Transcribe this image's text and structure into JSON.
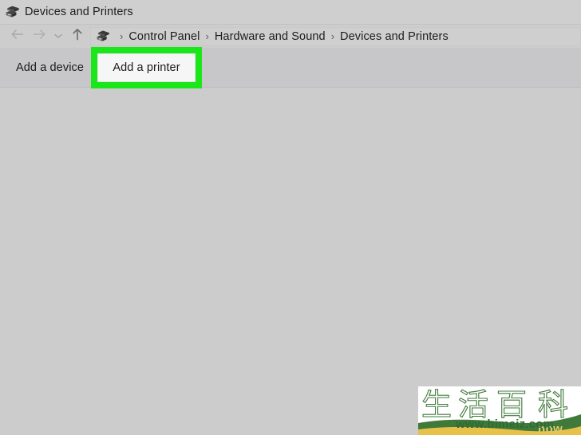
{
  "window": {
    "title": "Devices and Printers",
    "title_icon": "printer-icon"
  },
  "address_bar": {
    "back_icon": "back-arrow-icon",
    "forward_icon": "forward-arrow-icon",
    "recent_icon": "chevron-down-icon",
    "up_icon": "up-arrow-icon",
    "path_icon": "printer-icon",
    "separator": "›",
    "crumbs": [
      {
        "label": "Control Panel"
      },
      {
        "label": "Hardware and Sound"
      },
      {
        "label": "Devices and Printers"
      }
    ]
  },
  "toolbar": {
    "add_device_label": "Add a device",
    "add_printer_label": "Add a printer",
    "highlight_color": "#1ae61a"
  },
  "colors": {
    "content_background": "#cccccc",
    "toolbar_background": "#c7c7c9",
    "title_background": "#cfcfcf",
    "highlight_green": "#1ae61a"
  },
  "watermark": {
    "cjk_text": "生活百科",
    "cjk_chars": [
      "生",
      "活",
      "百",
      "科"
    ],
    "url": "www.bimeiz.com",
    "ghost_text": "now",
    "green": "#3f7a3a",
    "yellow": "#e8c14a"
  }
}
